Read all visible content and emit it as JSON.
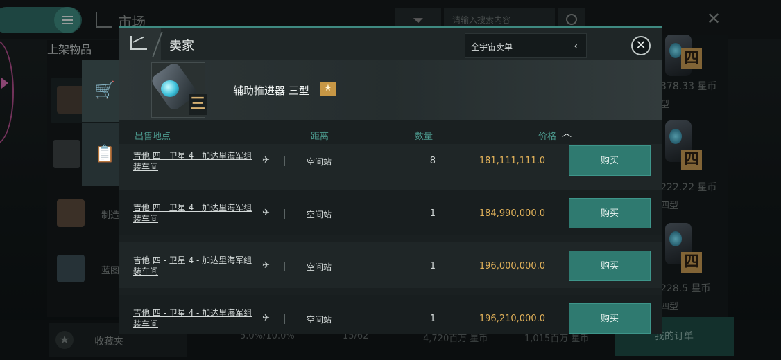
{
  "background": {
    "market_title": "市场",
    "search_placeholder": "请输入搜索内容",
    "left_list": {
      "header": "上架物品",
      "items": [
        {
          "label": ""
        },
        {
          "label": ""
        },
        {
          "label": "制造"
        },
        {
          "label": "蓝图"
        }
      ]
    },
    "right_products": [
      {
        "tier": "四",
        "price": "378.33 星币",
        "sub": "型"
      },
      {
        "tier": "四",
        "price": "222.22 星币",
        "sub": "四型"
      },
      {
        "tier": "四",
        "price": "228.5 星币",
        "sub": "四型"
      }
    ],
    "bottom": {
      "favorites_label": "收藏夹",
      "stats": [
        "5.0%/10.0%",
        "15/62",
        "4,720百万 星币",
        "1,015百万 星币"
      ],
      "orders_button": "我的订单"
    }
  },
  "dialog": {
    "title": "卖家",
    "scope_select": "全宇宙卖单",
    "item": {
      "name": "辅助推进器 三型",
      "tier": "三"
    },
    "columns": {
      "location": "出售地点",
      "distance": "距离",
      "quantity": "数量",
      "price": "价格"
    },
    "rows": [
      {
        "location": "吉他 四 - 卫星 4 - 加达里海军组装车间",
        "distance": "空间站",
        "quantity": "8",
        "price": "181,111,111.0",
        "buy": "购买"
      },
      {
        "location": "吉他 四 - 卫星 4 - 加达里海军组装车间",
        "distance": "空间站",
        "quantity": "1",
        "price": "184,990,000.0",
        "buy": "购买"
      },
      {
        "location": "吉他 四 - 卫星 4 - 加达里海军组装车间",
        "distance": "空间站",
        "quantity": "1",
        "price": "196,000,000.0",
        "buy": "购买"
      },
      {
        "location": "吉他 四 - 卫星 4 - 加达里海军组装车间",
        "distance": "空间站",
        "quantity": "1",
        "price": "196,210,000.0",
        "buy": "购买"
      }
    ]
  },
  "icons": {
    "menu": "hamburger-icon",
    "market": "chart-line-icon",
    "filter": "filter-icon",
    "search": "search-icon",
    "close": "close-icon",
    "location": "ship-icon",
    "sort": "chevron-up-icon",
    "cart": "cart-icon",
    "orders_list": "clipboard-icon",
    "favorite": "star-icon"
  },
  "colors": {
    "accent": "#2f7a70",
    "price": "#e2b25a",
    "tier_badge": "#c79a54",
    "column_header": "#4c9a8e"
  }
}
